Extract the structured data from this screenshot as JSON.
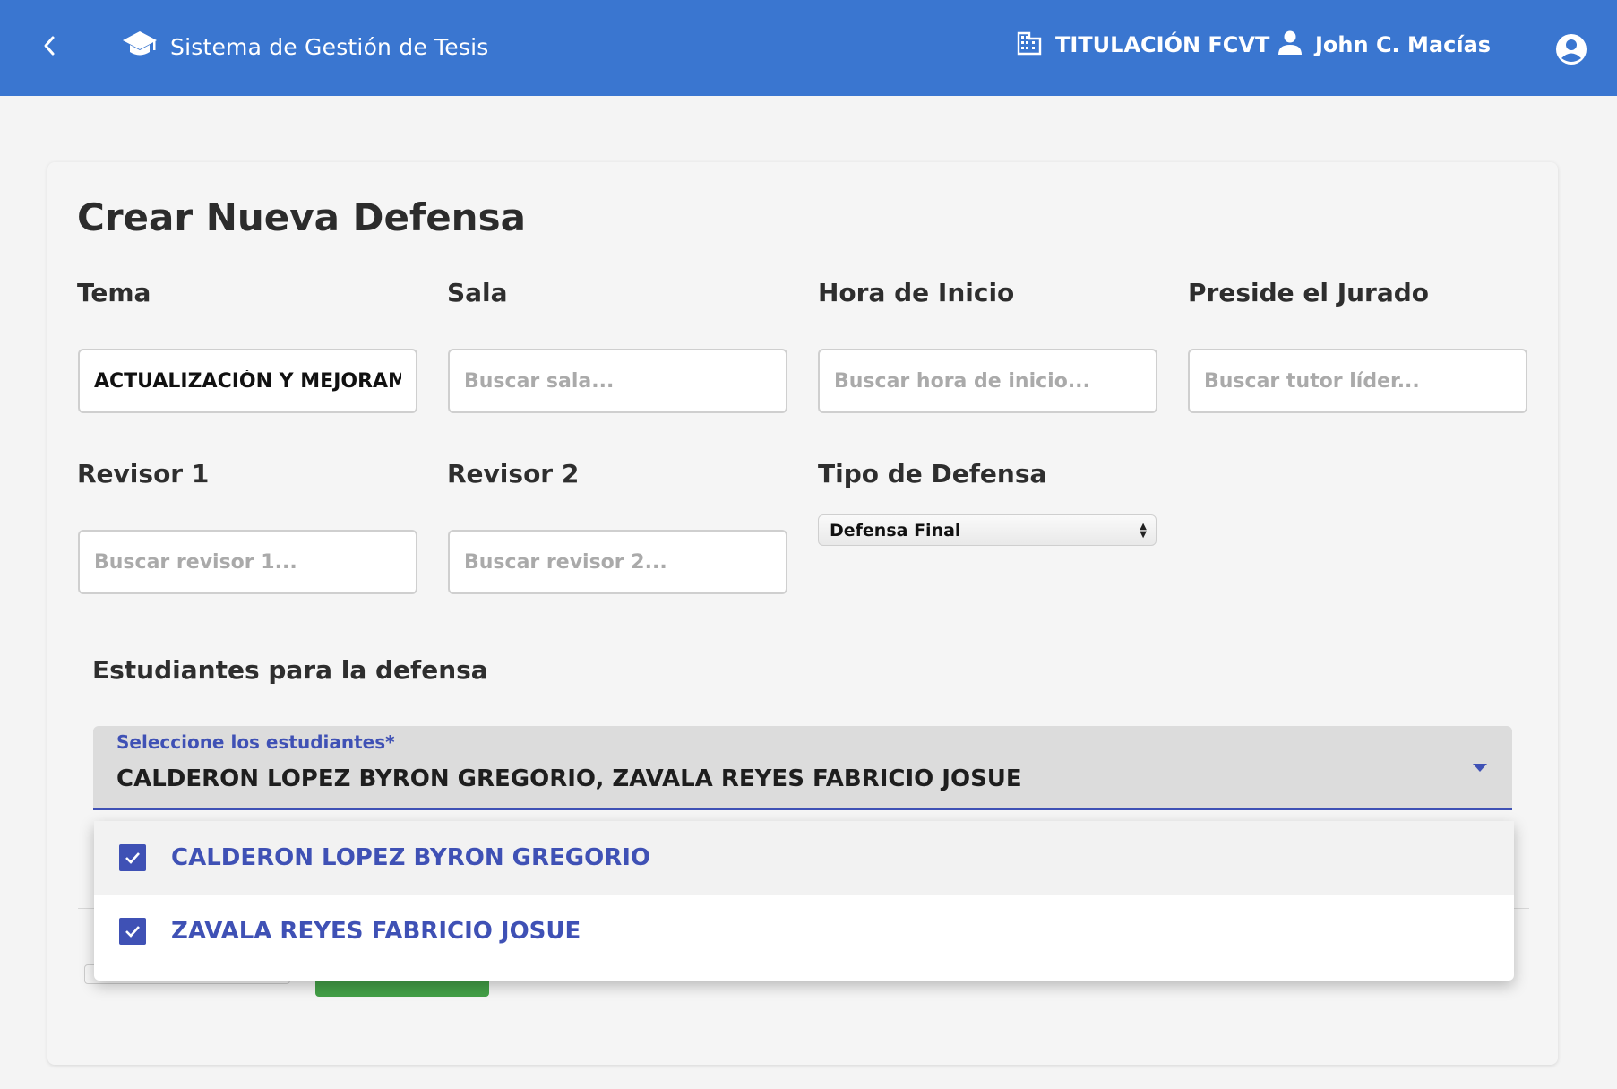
{
  "header": {
    "back_icon": "chevron-left-icon",
    "app_icon": "graduation-cap-icon",
    "app_title": "Sistema de Gestión de Tesis",
    "org_icon": "building-icon",
    "org_name": "TITULACIÓN FCVT",
    "user_icon": "person-icon",
    "user_name": "John C. Macías",
    "account_icon": "account-circle-icon",
    "bar_color": "#3a76d0"
  },
  "form": {
    "title": "Crear Nueva Defensa",
    "tema": {
      "label": "Tema",
      "value": "ACTUALIZACIÓN Y MEJORAM",
      "placeholder": ""
    },
    "sala": {
      "label": "Sala",
      "value": "",
      "placeholder": "Buscar sala..."
    },
    "hora": {
      "label": "Hora de Inicio",
      "value": "",
      "placeholder": "Buscar hora de inicio..."
    },
    "preside": {
      "label": "Preside el Jurado",
      "value": "",
      "placeholder": "Buscar tutor líder..."
    },
    "revisor1": {
      "label": "Revisor 1",
      "value": "",
      "placeholder": "Buscar revisor 1..."
    },
    "revisor2": {
      "label": "Revisor 2",
      "value": "",
      "placeholder": "Buscar revisor 2..."
    },
    "tipo": {
      "label": "Tipo de Defensa",
      "selected": "Defensa Final"
    }
  },
  "students": {
    "section_title": "Estudiantes para la defensa",
    "select_label": "Seleccione los estudiantes*",
    "selected_text": "CALDERON LOPEZ BYRON GREGORIO, ZAVALA REYES FABRICIO JOSUE",
    "options": [
      {
        "label": "CALDERON LOPEZ BYRON GREGORIO",
        "checked": true
      },
      {
        "label": "ZAVALA REYES FABRICIO JOSUE",
        "checked": true
      }
    ],
    "accent_color": "#3f51b5"
  }
}
